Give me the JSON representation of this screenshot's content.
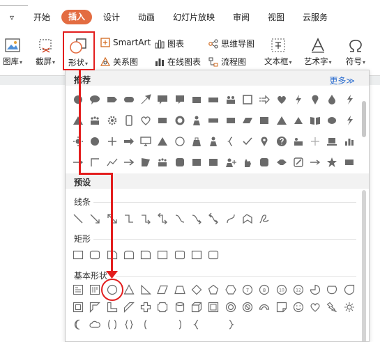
{
  "tabs": [
    {
      "label": "开始"
    },
    {
      "label": "插入",
      "active": true
    },
    {
      "label": "设计"
    },
    {
      "label": "动画"
    },
    {
      "label": "幻灯片放映"
    },
    {
      "label": "审阅"
    },
    {
      "label": "视图"
    },
    {
      "label": "云服务"
    }
  ],
  "tabs_menu_glyph": "▿",
  "ribbon": {
    "picture": "图库",
    "screenshot": "截屏",
    "shape": "形状",
    "smartart": "SmartArt",
    "chart": "图表",
    "mindmap": "思维导图",
    "relation": "关系图",
    "online_chart": "在线图表",
    "flowchart": "流程图",
    "textbox": "文本框",
    "wordart": "艺术字",
    "symbol": "符号"
  },
  "panel": {
    "recommended": "推荐",
    "more": "更多≫",
    "preset": "预设",
    "lines": "线条",
    "rect": "矩形",
    "basic": "基本形状"
  },
  "colors": {
    "accent": "#e36c41",
    "annotation": "#e31e1e",
    "shape_fill": "#6a6a6a",
    "link": "#3070d0"
  }
}
